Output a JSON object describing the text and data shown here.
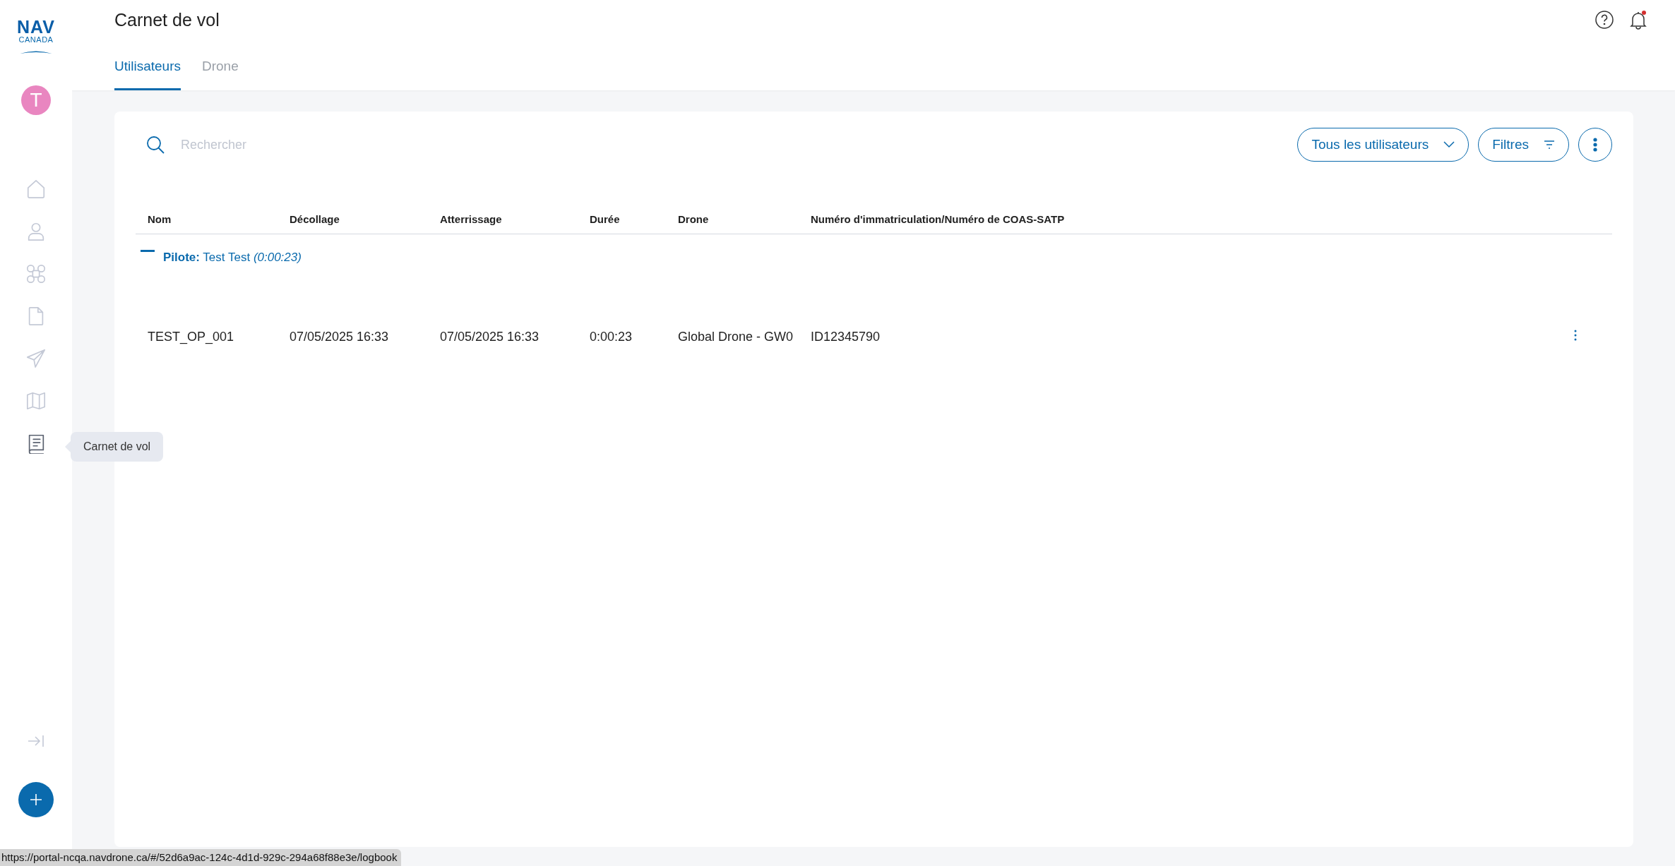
{
  "sidebar": {
    "logo": {
      "line_1": "NAV",
      "line_2": "CANADA"
    },
    "avatar": "T",
    "nav_items": [
      {
        "kind": "home",
        "selected": false
      },
      {
        "kind": "user",
        "selected": false
      },
      {
        "kind": "drone",
        "selected": false
      },
      {
        "kind": "document",
        "selected": false
      },
      {
        "kind": "send",
        "selected": false
      },
      {
        "kind": "map",
        "selected": false
      },
      {
        "kind": "logbook",
        "selected": true
      }
    ],
    "tooltip": "Carnet de vol"
  },
  "header": {
    "title": "Carnet de vol",
    "notification_unread": true,
    "tabs": [
      {
        "label": "Utilisateurs",
        "selected": true
      },
      {
        "label": "Drone",
        "selected": false
      }
    ]
  },
  "toolbar": {
    "search": {
      "placeholder": "Rechercher"
    },
    "user_filter": "Tous les utilisateurs",
    "filters": "Filtres"
  },
  "table": {
    "columns": [
      "Nom",
      "Décollage",
      "Atterrissage",
      "Durée",
      "Drone",
      "Numéro d'immatriculation/Numéro de COAS-SATP"
    ],
    "groups": [
      {
        "label": "**Pilote:** Test Test *(0:00:23)*",
        "expanded": true,
        "rows": [
          {
            "cells": [
              "TEST_OP_001",
              "07/05/2025 16:33",
              "07/05/2025 16:33",
              "0:00:23",
              "Global Drone - GW0",
              "ID12345790"
            ]
          }
        ]
      }
    ]
  },
  "status_bar": {
    "url": "https://portal-ncqa.navdrone.ca/#/52d6a9ac-124c-4d1d-929c-294a68f88e3e/logbook"
  }
}
